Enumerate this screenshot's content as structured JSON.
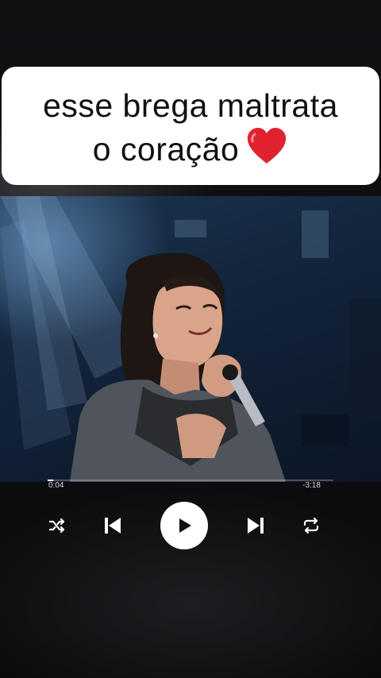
{
  "caption": {
    "line1": "esse brega maltrata",
    "line2": "o coração"
  },
  "player": {
    "time_elapsed": "0:04",
    "time_remaining": "-3:18",
    "progress": 0.02
  },
  "icons": {
    "heart": "red-heart-emoji",
    "shuffle": "shuffle-icon",
    "previous": "skip-previous-icon",
    "play": "play-icon",
    "next": "skip-next-icon",
    "repeat": "repeat-icon"
  },
  "colors": {
    "heart": "#e0222f",
    "card_bg": "#ffffff",
    "controls": "#ffffff"
  }
}
